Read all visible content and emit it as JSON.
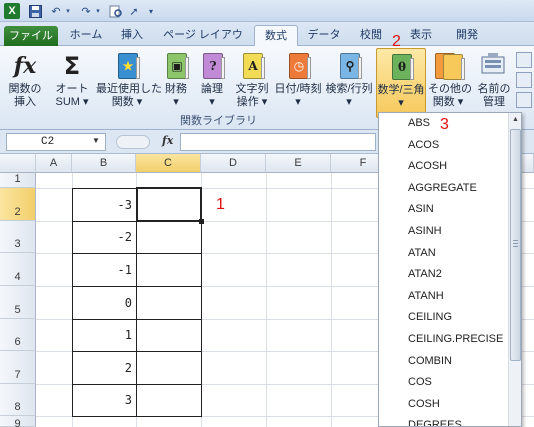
{
  "titlebar": {
    "icons": [
      "excel-app-icon",
      "save-icon",
      "undo-icon",
      "redo-icon",
      "print-preview-icon",
      "cursor-icon"
    ]
  },
  "tabs": [
    {
      "label": "ファイル",
      "kind": "file"
    },
    {
      "label": "ホーム"
    },
    {
      "label": "挿入"
    },
    {
      "label": "ページ レイアウト"
    },
    {
      "label": "数式",
      "active": true
    },
    {
      "label": "データ"
    },
    {
      "label": "校閲"
    },
    {
      "label": "表示"
    },
    {
      "label": "開発"
    }
  ],
  "ribbon": {
    "buttons": [
      {
        "line1": "関数の",
        "line2": "挿入",
        "icon": "fx-icon"
      },
      {
        "line1": "オート",
        "line2": "SUM ▾",
        "icon": "sigma-icon"
      },
      {
        "line1": "最近使用した",
        "line2": "関数 ▾",
        "icon": "recent-functions-icon"
      },
      {
        "line1": "財務",
        "line2": "▾",
        "icon": "financial-icon"
      },
      {
        "line1": "論理",
        "line2": "▾",
        "icon": "logical-icon"
      },
      {
        "line1": "文字列",
        "line2": "操作 ▾",
        "icon": "text-icon"
      },
      {
        "line1": "日付/時刻",
        "line2": "▾",
        "icon": "date-time-icon"
      },
      {
        "line1": "検索/行列",
        "line2": "▾",
        "icon": "lookup-icon"
      },
      {
        "line1": "数学/三角",
        "line2": "▾",
        "icon": "math-trig-icon",
        "selected": true
      },
      {
        "line1": "その他の",
        "line2": "関数 ▾",
        "icon": "more-functions-icon"
      },
      {
        "line1": "名前の",
        "line2": "管理",
        "icon": "name-manager-icon"
      }
    ],
    "group_label": "関数ライブラリ"
  },
  "formula_bar": {
    "name_box": "C2",
    "fx_label": "fx"
  },
  "grid": {
    "columns": [
      "A",
      "B",
      "C",
      "D",
      "E",
      "F"
    ],
    "selected_column": "C",
    "rows": [
      "1",
      "2",
      "3",
      "4",
      "5",
      "6",
      "7",
      "8",
      "9"
    ],
    "selected_row": "2",
    "b_values": [
      "",
      "-3",
      "-2",
      "-1",
      "0",
      "1",
      "2",
      "3"
    ]
  },
  "dropdown": {
    "items": [
      "ABS",
      "ACOS",
      "ACOSH",
      "AGGREGATE",
      "ASIN",
      "ASINH",
      "ATAN",
      "ATAN2",
      "ATANH",
      "CEILING",
      "CEILING.PRECISE",
      "COMBIN",
      "COS",
      "COSH",
      "DEGREES"
    ]
  },
  "annotations": [
    "1",
    "2",
    "3"
  ],
  "colors": {
    "annotation": "#e01010",
    "file_tab": "#2a7d2a",
    "selected_header": "#f2cf6b"
  }
}
